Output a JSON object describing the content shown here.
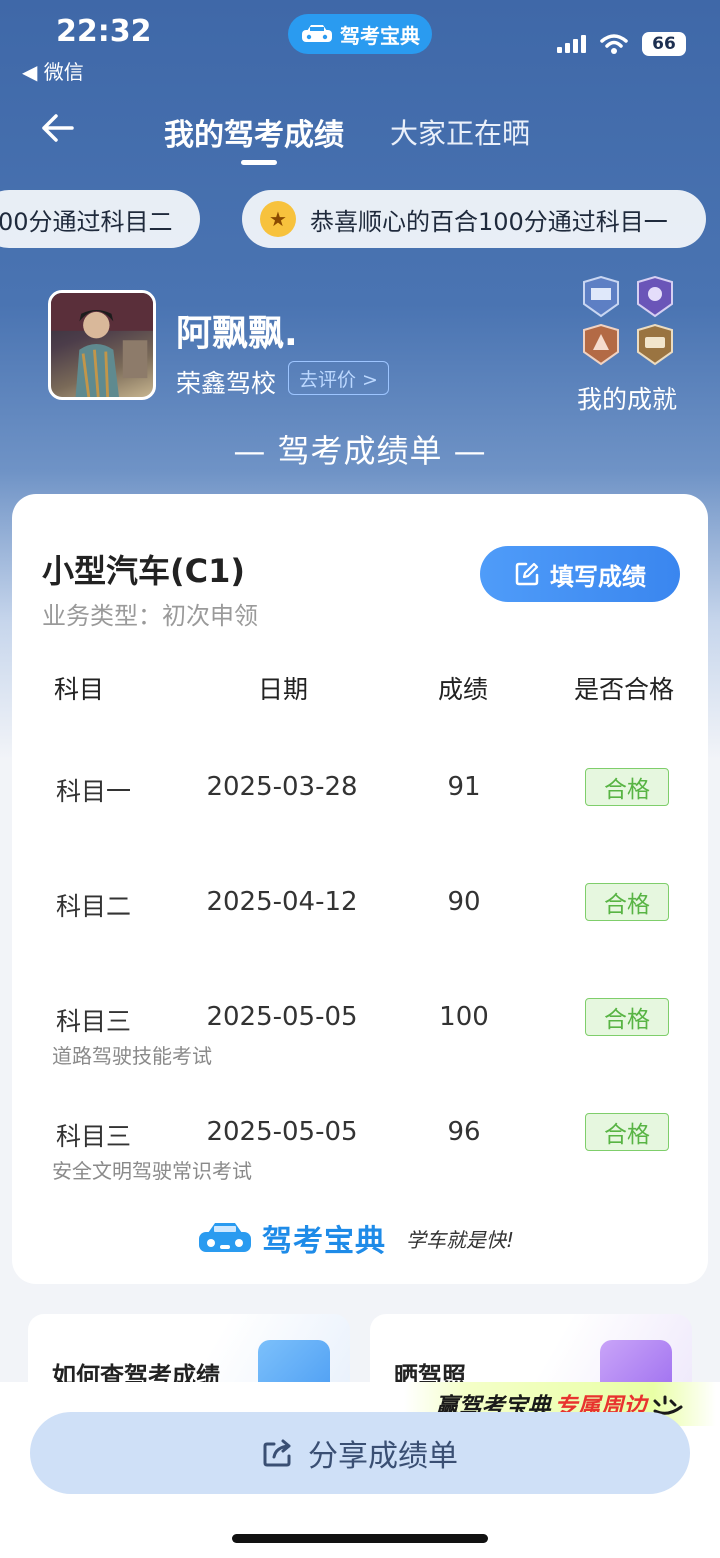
{
  "status_bar": {
    "time": "22:32",
    "back_app": "◀ 微信",
    "app_name": "驾考宝典",
    "battery": "66"
  },
  "nav": {
    "tab_active": "我的驾考成绩",
    "tab_other": "大家正在晒"
  },
  "marquee": [
    {
      "text": "00分通过科目二"
    },
    {
      "text": "恭喜顺心的百合100分通过科目一"
    }
  ],
  "profile": {
    "name": "阿飘飘.",
    "school": "荣鑫驾校",
    "rate_label": "去评价 >",
    "achievements_label": "我的成就"
  },
  "sheet_title": "— 驾考成绩单 —",
  "card": {
    "car_type": "小型汽车(C1)",
    "business_type": "业务类型：初次申领",
    "fill_button": "填写成绩",
    "headers": [
      "科目",
      "日期",
      "成绩",
      "是否合格"
    ],
    "rows": [
      {
        "subject": "科目一",
        "note": "",
        "date": "2025-03-28",
        "score": "91",
        "status": "合格"
      },
      {
        "subject": "科目二",
        "note": "",
        "date": "2025-04-12",
        "score": "90",
        "status": "合格"
      },
      {
        "subject": "科目三",
        "note": "道路驾驶技能考试",
        "date": "2025-05-05",
        "score": "100",
        "status": "合格"
      },
      {
        "subject": "科目三",
        "note": "安全文明驾驶常识考试",
        "date": "2025-05-05",
        "score": "96",
        "status": "合格"
      }
    ],
    "logo_text": "驾考宝典",
    "slogan": "学车就是快!"
  },
  "tiles": [
    {
      "label": "如何查驾考成绩"
    },
    {
      "label": "晒驾照"
    }
  ],
  "promo": {
    "part1": "赢驾考宝典",
    "part2": "专属周边"
  },
  "share_button": "分享成绩单",
  "colors": {
    "header_blue": "#4a74b2",
    "accent_blue": "#3a86ef",
    "pass_green": "#58b444",
    "pass_bg": "#e6f7df",
    "share_bg": "#cfe0f7"
  }
}
